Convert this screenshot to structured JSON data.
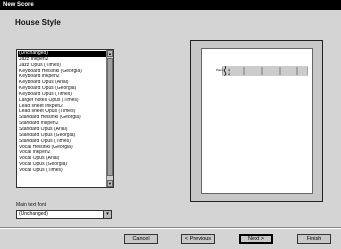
{
  "window": {
    "title": "New Score"
  },
  "section": {
    "title": "House Style"
  },
  "house_styles": {
    "items": [
      "(Unchanged)",
      "Jazz Inkpen2",
      "Jazz Opus (Times)",
      "Keyboard Helsinki (Georgia)",
      "Keyboard Inkpen2",
      "Keyboard Opus (Arial)",
      "Keyboard Opus (Georgia)",
      "Keyboard Opus (Times)",
      "Larger notes Opus (Times)",
      "Lead sheet Inkpen2",
      "Lead sheet Opus (Times)",
      "Standard Helsinki (Georgia)",
      "Standard Inkpen2",
      "Standard Opus (Arial)",
      "Standard Opus (Georgia)",
      "Standard Opus (Times)",
      "Vocal Helsinki (Georgia)",
      "Vocal Inkpen2",
      "Vocal Opus (Arial)",
      "Vocal Opus (Georgia)",
      "Vocal Opus (Times)"
    ],
    "selected": "(Unchanged)"
  },
  "main_text_font": {
    "label": "Main text font",
    "value": "(Unchanged)"
  },
  "preview": {
    "staff_label": "Piano"
  },
  "buttons": {
    "cancel": "Cancel",
    "previous": "< Previous",
    "next": "Next >",
    "finish": "Finish"
  }
}
